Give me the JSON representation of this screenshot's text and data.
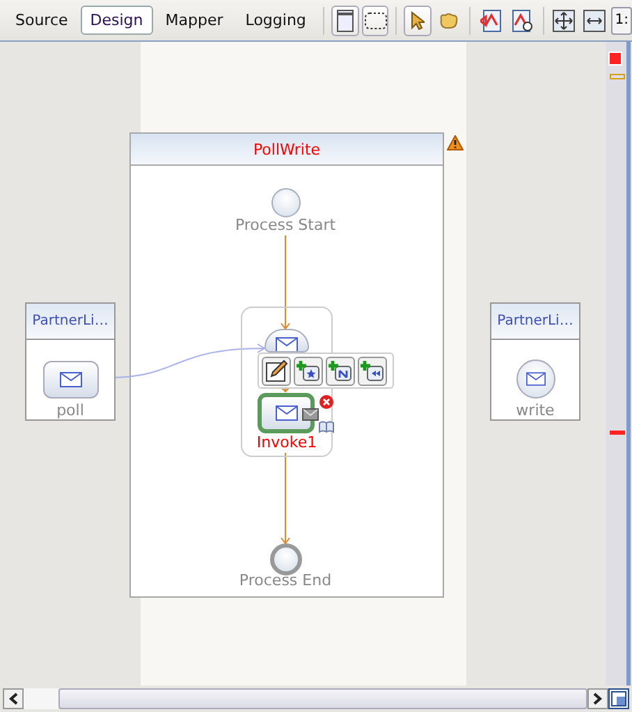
{
  "tabs": [
    {
      "label": "Source",
      "selected": false
    },
    {
      "label": "Design",
      "selected": true
    },
    {
      "label": "Mapper",
      "selected": false
    },
    {
      "label": "Logging",
      "selected": false
    }
  ],
  "zoom_button": {
    "label": "1:"
  },
  "process": {
    "title": "PollWrite"
  },
  "nodes": [
    {
      "kind": "start",
      "label": "Process Start",
      "selected": false
    },
    {
      "kind": "invoke",
      "label": "Invoke1",
      "selected": true
    },
    {
      "kind": "end",
      "label": "Process End",
      "selected": false
    }
  ],
  "partner_links": [
    {
      "title": "PartnerLi…",
      "label": "poll",
      "kind": "box"
    },
    {
      "title": "PartnerLi…",
      "label": "write",
      "kind": "circle"
    }
  ]
}
